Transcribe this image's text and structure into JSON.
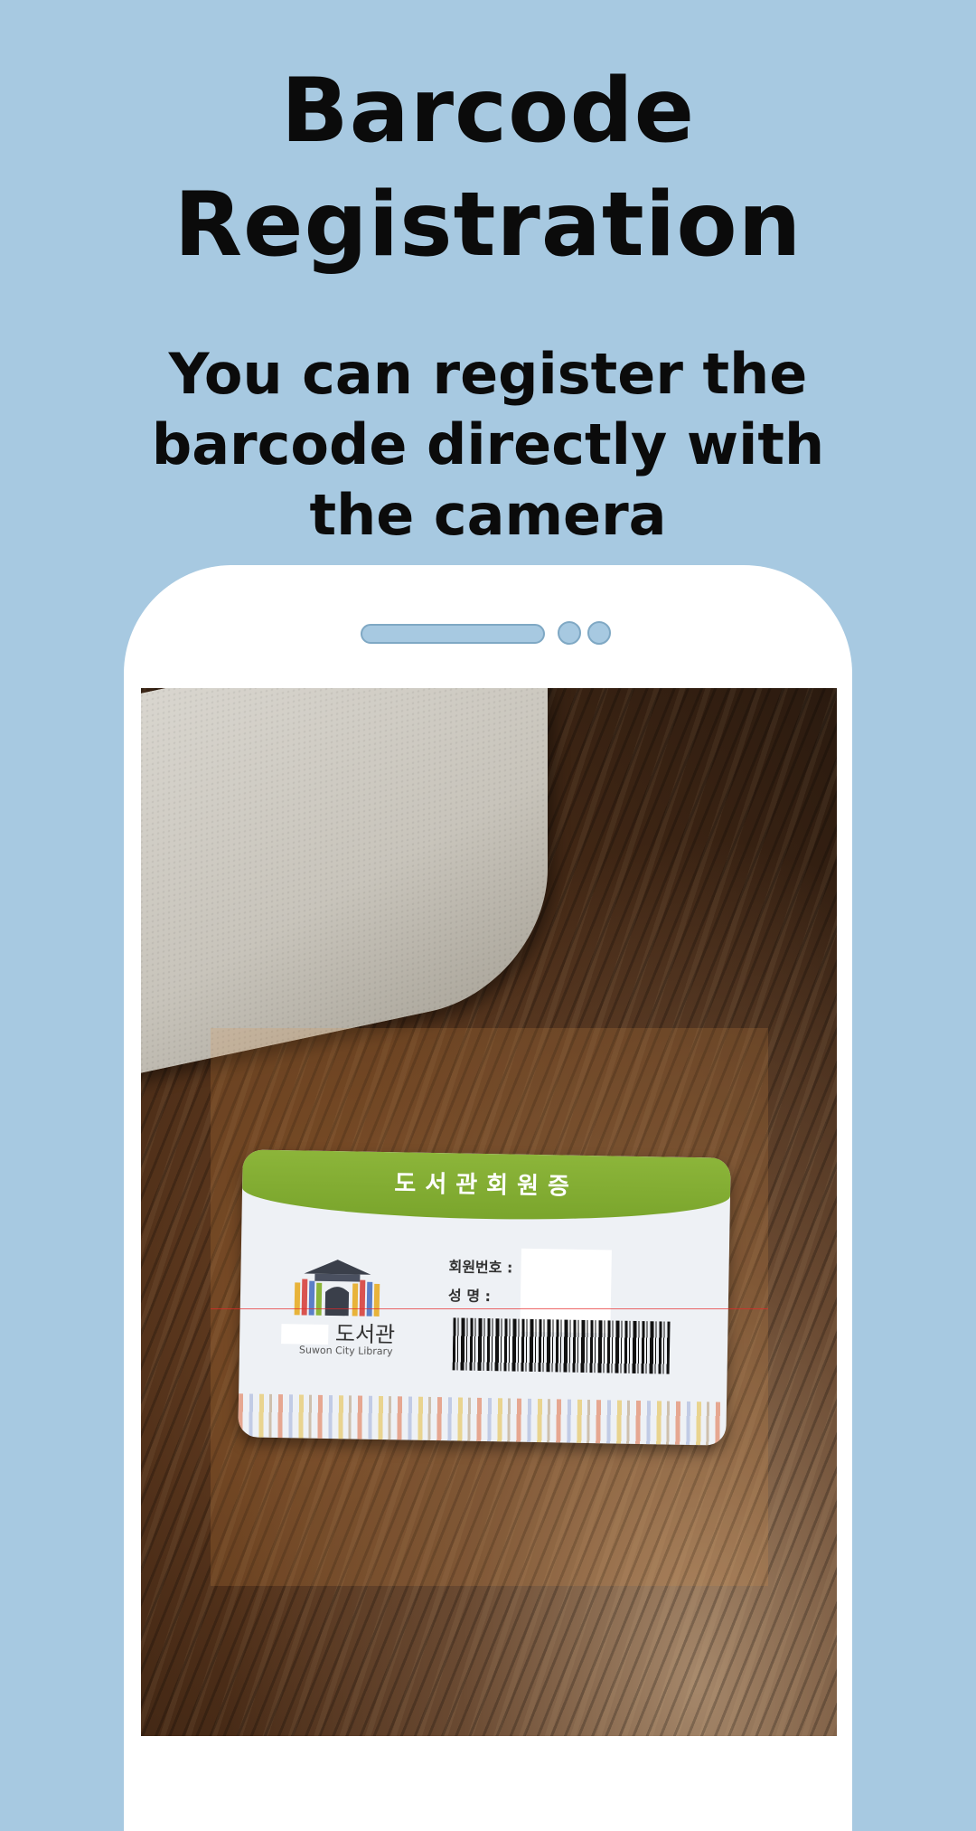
{
  "headline": {
    "line1": "Barcode",
    "line2": "Registration"
  },
  "subtitle": {
    "line1": "You can register the",
    "line2": "barcode directly with",
    "line3": "the camera"
  },
  "card": {
    "title": "도서관회원증",
    "field_member_no": "회원번호 :",
    "field_name": "성    명 :",
    "library_name": "도서관",
    "library_sub": "Suwon City Library"
  },
  "colors": {
    "background": "#a7c9e1",
    "phone_body": "#ffffff",
    "card_band": "#8cb53a",
    "scan_line": "#e62828"
  }
}
